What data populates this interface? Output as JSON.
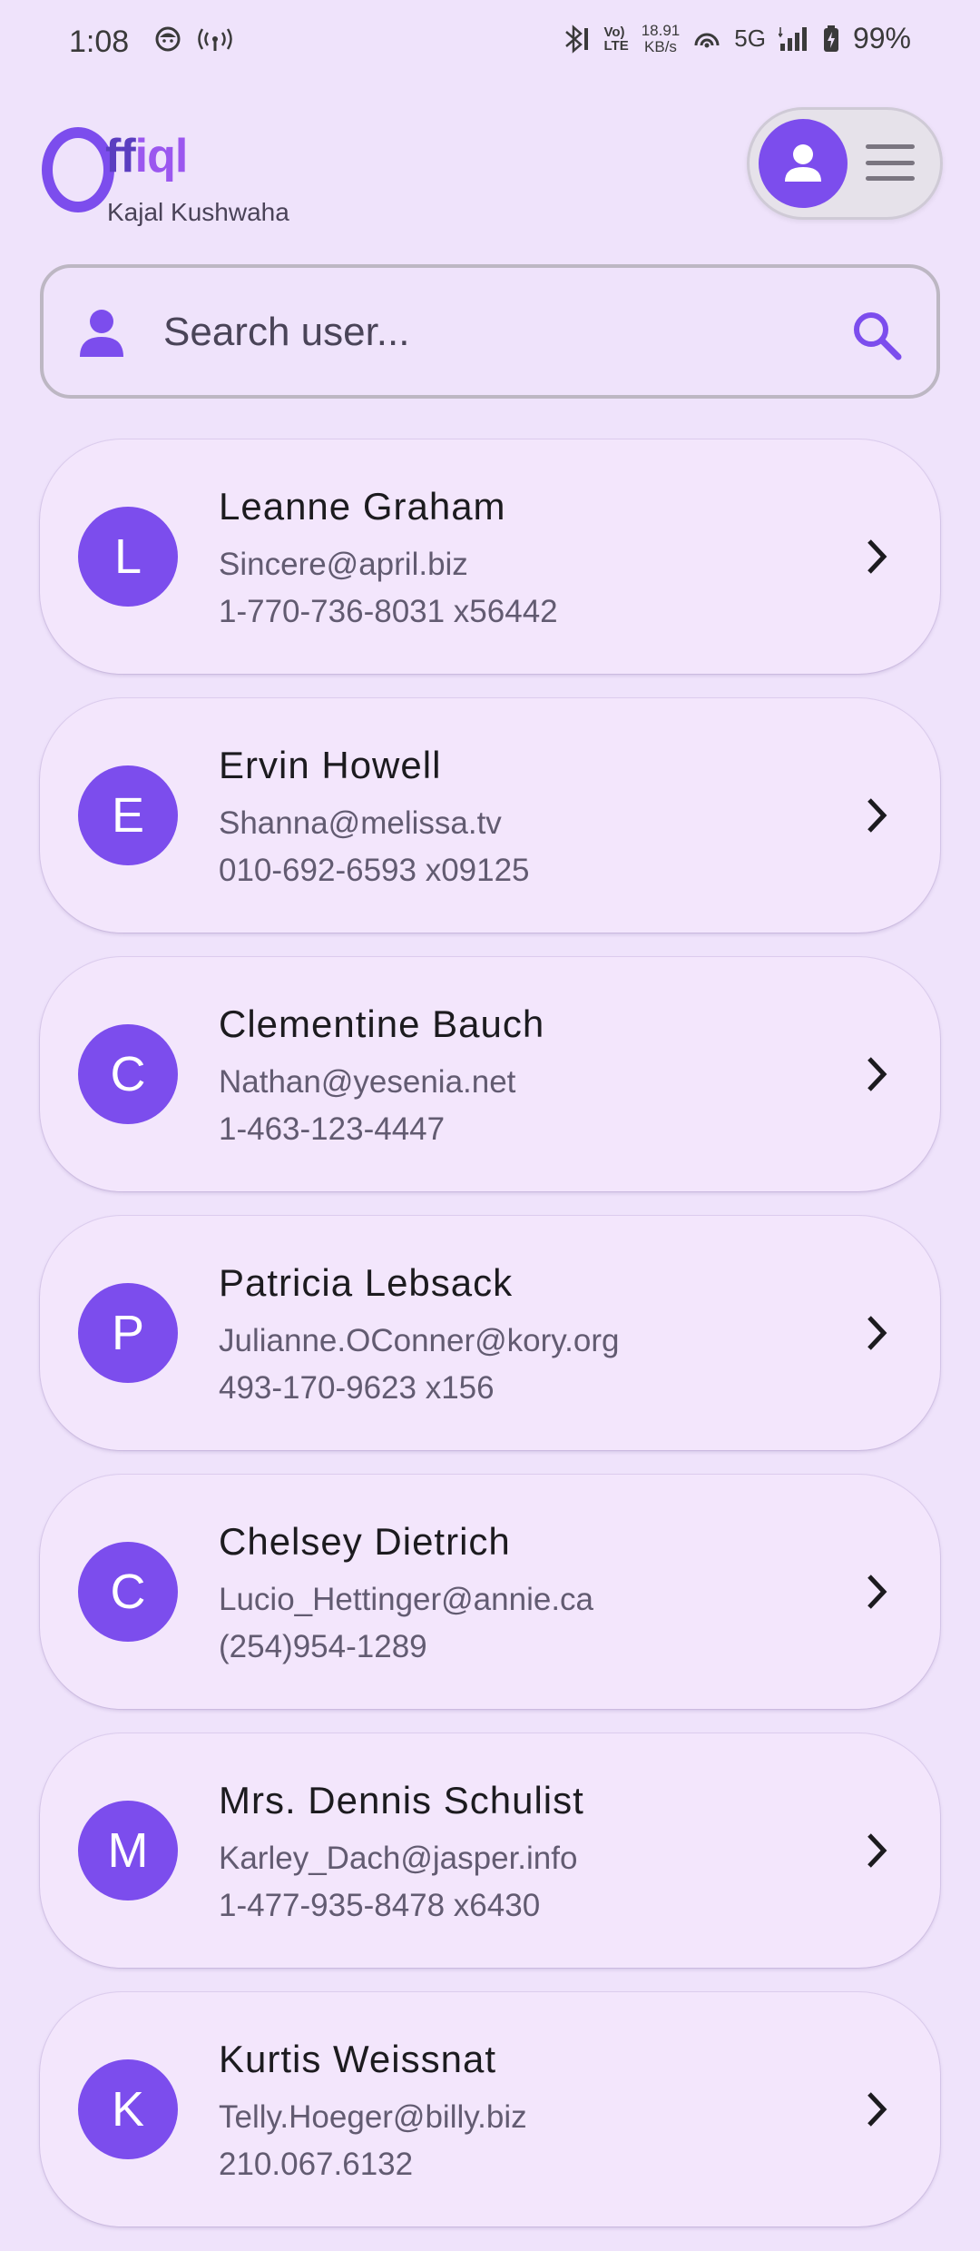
{
  "status_bar": {
    "time": "1:08",
    "net_speed_value": "18.91",
    "net_speed_unit": "KB/s",
    "volte_top": "Vo)",
    "volte_bottom": "LTE",
    "network": "5G",
    "battery": "99%"
  },
  "header": {
    "logo_o": "O",
    "logo_ff": "ff",
    "logo_iql": "iql",
    "user_name": "Kajal Kushwaha"
  },
  "search": {
    "placeholder": "Search user..."
  },
  "users": [
    {
      "initial": "L",
      "name": "Leanne Graham",
      "email": "Sincere@april.biz",
      "phone": "1-770-736-8031 x56442"
    },
    {
      "initial": "E",
      "name": "Ervin Howell",
      "email": "Shanna@melissa.tv",
      "phone": "010-692-6593 x09125"
    },
    {
      "initial": "C",
      "name": "Clementine Bauch",
      "email": "Nathan@yesenia.net",
      "phone": "1-463-123-4447"
    },
    {
      "initial": "P",
      "name": "Patricia Lebsack",
      "email": "Julianne.OConner@kory.org",
      "phone": "493-170-9623 x156"
    },
    {
      "initial": "C",
      "name": "Chelsey Dietrich",
      "email": "Lucio_Hettinger@annie.ca",
      "phone": "(254)954-1289"
    },
    {
      "initial": "M",
      "name": "Mrs. Dennis Schulist",
      "email": "Karley_Dach@jasper.info",
      "phone": "1-477-935-8478 x6430"
    },
    {
      "initial": "K",
      "name": "Kurtis Weissnat",
      "email": "Telly.Hoeger@billy.biz",
      "phone": "210.067.6132"
    }
  ],
  "colors": {
    "accent": "#7c4ded",
    "background": "#efe3fb",
    "card": "#f3e6fc"
  }
}
